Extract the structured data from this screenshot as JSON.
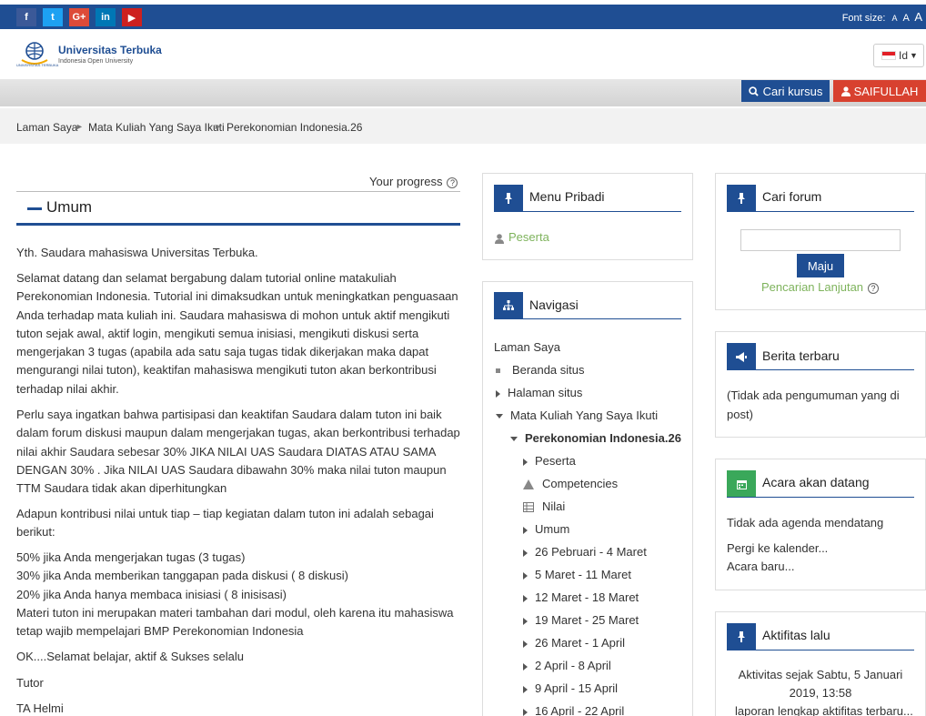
{
  "topbar": {
    "social": [
      {
        "icon": "facebook-icon",
        "glyph": "f",
        "color": "#3b5998"
      },
      {
        "icon": "twitter-icon",
        "glyph": "t",
        "color": "#1da1f2"
      },
      {
        "icon": "google-plus-icon",
        "glyph": "G+",
        "color": "#dd4b39"
      },
      {
        "icon": "linkedin-icon",
        "glyph": "in",
        "color": "#0077b5"
      },
      {
        "icon": "youtube-icon",
        "glyph": "▶",
        "color": "#cd201f"
      }
    ],
    "font_size_label": "Font size:",
    "font_a_small": "A",
    "font_a_medium": "A",
    "font_a_large": "A"
  },
  "header": {
    "logo_title": "Universitas Terbuka",
    "logo_subtitle": "Indonesia Open University",
    "logo_mark_text": "UNIVERSITAS TERBUKA",
    "lang": "Id"
  },
  "toolbar": {
    "search_course": "Cari kursus",
    "user_name": "SAIFULLAH"
  },
  "breadcrumb": [
    "Laman Saya",
    "Mata Kuliah Yang Saya Ikuti",
    "Perekonomian Indonesia.26"
  ],
  "main": {
    "progress_label": "Your progress",
    "section_title": "Umum",
    "paragraphs": [
      "Yth. Saudara mahasiswa Universitas Terbuka.",
      "Selamat datang dan selamat bergabung dalam tutorial online matakuliah Perekonomian Indonesia. Tutorial ini dimaksudkan untuk meningkatkan penguasaan Anda terhadap mata kuliah ini. Saudara mahasiswa di mohon untuk aktif mengikuti tuton sejak awal, aktif login, mengikuti semua inisiasi, mengikuti diskusi serta mengerjakan 3 tugas (apabila ada satu saja tugas tidak dikerjakan maka dapat mengurangi nilai tuton), keaktifan mahasiswa mengikuti tuton akan berkontribusi terhadap nilai akhir.",
      "Perlu saya ingatkan bahwa partisipasi dan keaktifan Saudara  dalam tuton ini baik dalam forum diskusi maupun dalam mengerjakan tugas, akan berkontribusi terhadap nilai akhir Saudara sebesar 30% JIKA NILAI UAS Saudara DIATAS ATAU SAMA DENGAN 30% . Jika NILAI UAS Saudara dibawahn 30% maka nilai tuton maupun TTM Saudara tidak akan diperhitungkan",
      "Adapun kontribusi nilai untuk tiap – tiap kegiatan dalam tuton ini adalah sebagai berikut:",
      "50% jika Anda mengerjakan tugas (3 tugas)\n30% jika Anda memberikan tanggapan pada diskusi ( 8 diskusi)\n20% jika Anda hanya membaca inisiasi ( 8 inisisasi)\nMateri tuton ini merupakan materi tambahan dari modul, oleh karena itu mahasiswa tetap wajib mempelajari BMP Perekonomian Indonesia",
      "OK....Selamat belajar, aktif & Sukses selalu",
      "Tutor",
      "TA Helmi"
    ]
  },
  "menu_pribadi": {
    "title": "Menu Pribadi",
    "peserta": "Peserta"
  },
  "navigasi": {
    "title": "Navigasi",
    "laman_saya": "Laman Saya",
    "items": [
      {
        "label": "Beranda situs",
        "marker": "square",
        "indent": 0,
        "bold": false
      },
      {
        "label": "Halaman situs",
        "marker": "right",
        "indent": 0,
        "bold": false
      },
      {
        "label": "Mata Kuliah Yang Saya Ikuti",
        "marker": "down",
        "indent": 0,
        "bold": false
      },
      {
        "label": "Perekonomian Indonesia.26",
        "marker": "down",
        "indent": 1,
        "bold": true
      },
      {
        "label": "Peserta",
        "marker": "right",
        "indent": 2,
        "bold": false
      },
      {
        "label": "Competencies",
        "marker": "competency",
        "indent": 2,
        "bold": false
      },
      {
        "label": "Nilai",
        "marker": "grid",
        "indent": 2,
        "bold": false
      },
      {
        "label": "Umum",
        "marker": "right",
        "indent": 2,
        "bold": false
      },
      {
        "label": "26 Pebruari - 4 Maret",
        "marker": "right",
        "indent": 2,
        "bold": false
      },
      {
        "label": "5 Maret - 11 Maret",
        "marker": "right",
        "indent": 2,
        "bold": false
      },
      {
        "label": "12 Maret - 18 Maret",
        "marker": "right",
        "indent": 2,
        "bold": false
      },
      {
        "label": "19 Maret - 25 Maret",
        "marker": "right",
        "indent": 2,
        "bold": false
      },
      {
        "label": "26 Maret - 1 April",
        "marker": "right",
        "indent": 2,
        "bold": false
      },
      {
        "label": "2 April - 8 April",
        "marker": "right",
        "indent": 2,
        "bold": false
      },
      {
        "label": "9 April - 15 April",
        "marker": "right",
        "indent": 2,
        "bold": false
      },
      {
        "label": "16 April - 22 April",
        "marker": "right",
        "indent": 2,
        "bold": false
      }
    ]
  },
  "cari_forum": {
    "title": "Cari forum",
    "button": "Maju",
    "advanced": "Pencarian Lanjutan"
  },
  "berita": {
    "title": "Berita terbaru",
    "text": "(Tidak ada pengumuman yang di post)"
  },
  "acara": {
    "title": "Acara akan datang",
    "text": "Tidak ada agenda mendatang",
    "link1": "Pergi ke kalender...",
    "link2": "Acara baru..."
  },
  "aktifitas": {
    "title": "Aktifitas lalu",
    "text": "Aktivitas sejak Sabtu, 5 Januari 2019, 13:58",
    "link": "laporan lengkap aktifitas terbaru..."
  }
}
